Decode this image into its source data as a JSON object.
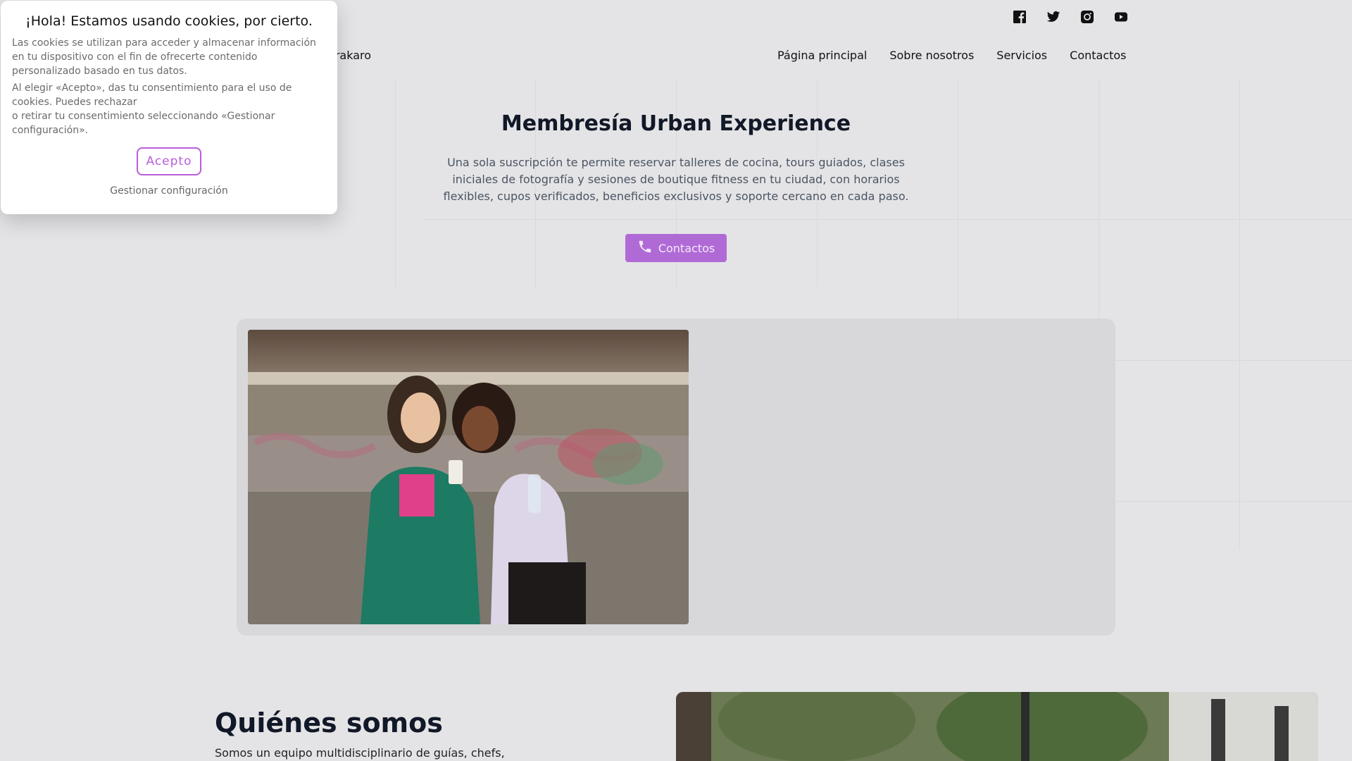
{
  "header": {
    "brand_fragment": "erakaro",
    "socials": [
      {
        "icon": "facebook-icon"
      },
      {
        "icon": "twitter-icon"
      },
      {
        "icon": "instagram-icon"
      },
      {
        "icon": "youtube-icon"
      }
    ],
    "nav": [
      {
        "label": "Página principal"
      },
      {
        "label": "Sobre nosotros"
      },
      {
        "label": "Servicios"
      },
      {
        "label": "Contactos"
      }
    ]
  },
  "hero": {
    "title": "Membresía Urban Experience",
    "description": "Una sola suscripción te permite reservar talleres de cocina, tours guiados, clases iniciales de fotografía y sesiones de boutique fitness en tu ciudad, con horarios flexibles, cupos verificados, beneficios exclusivos y soporte cercano en cada paso.",
    "button_label": "Contactos",
    "button_icon": "phone-icon"
  },
  "about": {
    "title": "Quiénes somos",
    "text": "Somos un equipo multidisciplinario de guías, chefs,"
  },
  "cookie": {
    "title": "¡Hola! Estamos usando cookies, por cierto.",
    "paragraph1": "Las cookies se utilizan para acceder y almacenar información en tu dispositivo con el fin de ofrecerte contenido personalizado basado en tus datos.",
    "paragraph2_line1": "Al elegir «Acepto», das tu consentimiento para el uso de cookies. Puedes rechazar",
    "paragraph2_line2": "o retirar tu consentimiento seleccionando «Gestionar configuración».",
    "accept_label": "Acepto",
    "manage_label": "Gestionar configuración"
  },
  "colors": {
    "accent": "#b06ad6",
    "background": "#e4e4e6",
    "heading": "#111827"
  }
}
